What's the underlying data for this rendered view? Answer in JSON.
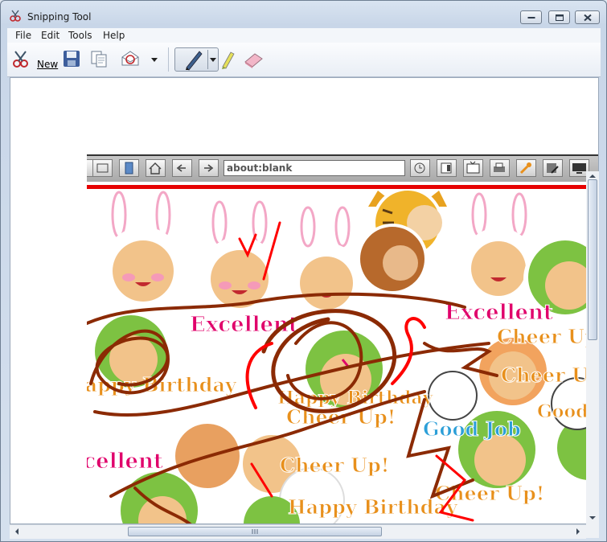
{
  "window": {
    "title": "Snipping Tool",
    "controls": [
      "minimize",
      "maximize",
      "close"
    ]
  },
  "menu": [
    "File",
    "Edit",
    "Tools",
    "Help"
  ],
  "toolbar": {
    "new_label": "New",
    "icons": [
      "scissors-icon",
      "save-icon",
      "copy-icon",
      "send-snip-icon",
      "dropdown-arrow-icon",
      "pen-icon",
      "pen-dropdown-icon",
      "highlighter-icon",
      "eraser-icon"
    ]
  },
  "snip": {
    "browser": {
      "address": "about:blank",
      "icons": [
        "window-icon",
        "restore-icon",
        "page-icon",
        "home-icon",
        "back-icon",
        "forward-icon",
        "history-icon",
        "favorites-icon",
        "media-icon",
        "print-icon",
        "tools-icon",
        "settings-icon",
        "display-icon"
      ]
    },
    "stickers": {
      "excellent": "Excellent",
      "cheer_up": "Cheer Up!",
      "happy_birthday": "Happy Birthday",
      "good_job": "Good Job"
    }
  },
  "colors": {
    "pen_ink": "#8b2a04",
    "red_ink": "#ff0000",
    "frog_green": "#7dc242",
    "sticker_orange": "#e8901c",
    "sticker_pink": "#e0006b"
  }
}
